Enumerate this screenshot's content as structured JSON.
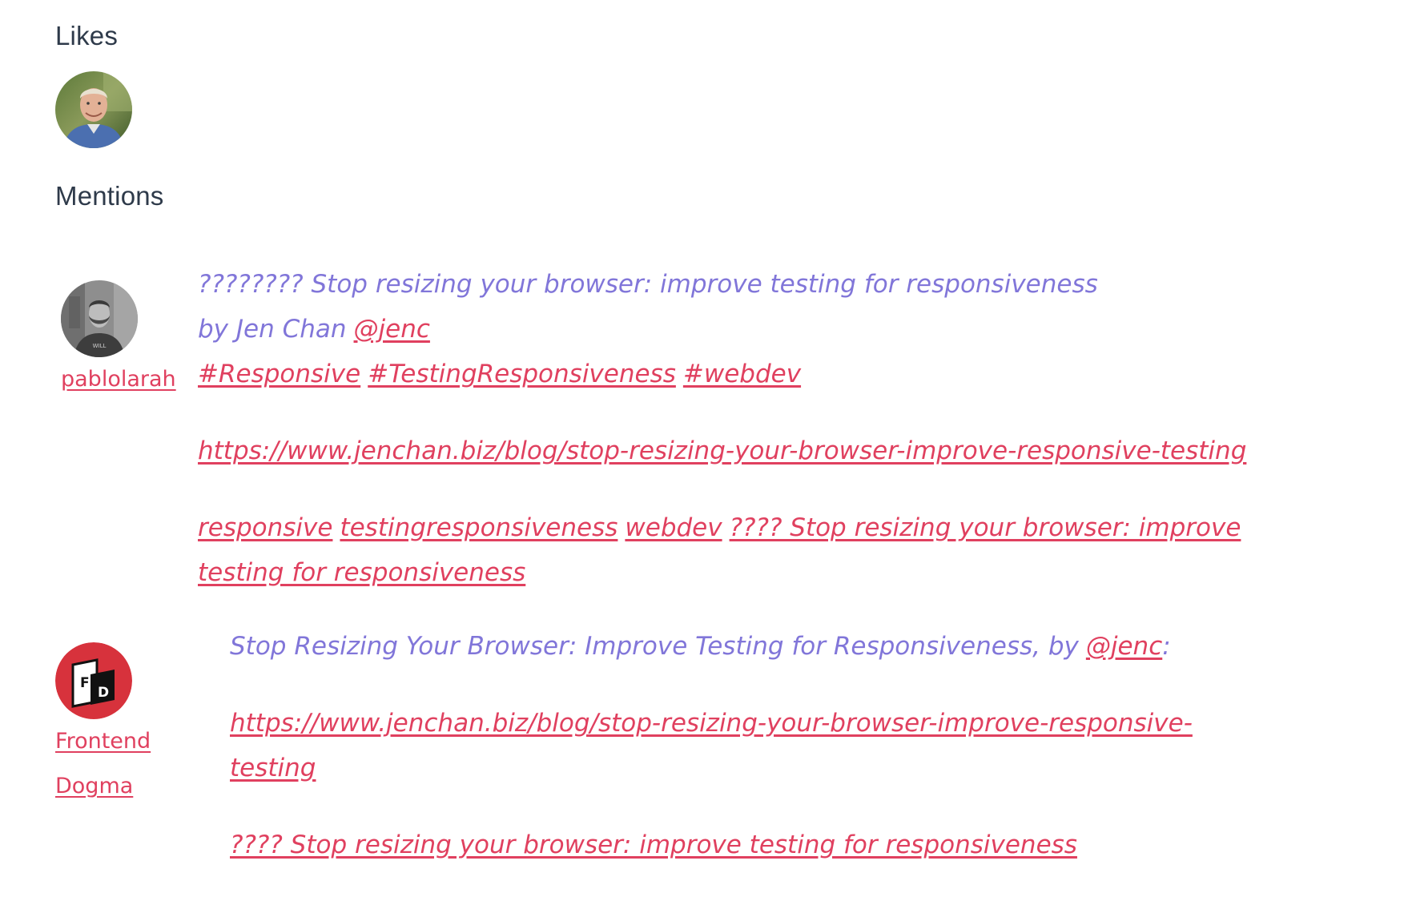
{
  "likes": {
    "heading": "Likes"
  },
  "mentions": {
    "heading": "Mentions",
    "items": [
      {
        "author": "pablolarah",
        "text_line1": "???????? Stop resizing your browser: improve testing for responsiveness",
        "by_prefix": "by Jen Chan",
        "handle": "@jenc",
        "hashtags": [
          "#Responsive",
          "#TestingResponsiveness",
          "#webdev"
        ],
        "url": "https://www.jenchan.biz/blog/stop-resizing-your-browser-improve-responsive-testing",
        "tag_links": [
          "responsive",
          "testingresponsiveness",
          "webdev"
        ],
        "title_link_line1": "???? Stop resizing your browser: improve",
        "title_link_line2": "testing for responsiveness"
      },
      {
        "author_line1": "Frontend",
        "author_line2": "Dogma",
        "intro": "Stop Resizing Your Browser: Improve Testing for Responsiveness, by",
        "handle": "@jenc",
        "colon": ":",
        "url_line1": "https://www.jenchan.biz/blog/stop-resizing-your-browser-improve-responsive-",
        "url_line2": "testing",
        "title_link": "???? Stop resizing your browser: improve testing for responsiveness"
      }
    ]
  },
  "colors": {
    "heading": "#2e3a4a",
    "link": "#e0405f",
    "quote_text": "#8176d9"
  },
  "icons": {
    "like_avatar": "person-avatar-photo",
    "pablolarah_avatar": "person-avatar-photo-grayscale",
    "frontend_dogma_avatar": "frontend-dogma-logo"
  }
}
